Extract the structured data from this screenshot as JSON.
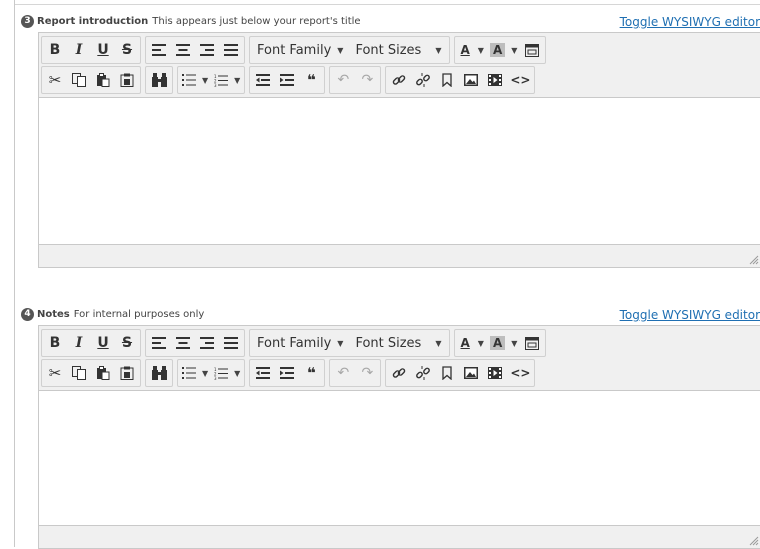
{
  "common": {
    "toggle_label": "Toggle WYSIWYG editor",
    "font_family_label": "Font Family",
    "font_sizes_label": "Font Sizes",
    "text_color_label": "A",
    "bg_color_label": "A",
    "bold": "B",
    "italic": "I",
    "underline": "U",
    "strikethrough": "S",
    "quote_glyph": "❝",
    "source_code_glyph": "<>"
  },
  "sections": [
    {
      "number": "3",
      "title": "Report introduction",
      "hint": "This appears just below your report's title"
    },
    {
      "number": "4",
      "title": "Notes",
      "hint": "For internal purposes only"
    }
  ],
  "toolbar_icons": {
    "row1": [
      "bold",
      "italic",
      "underline",
      "strikethrough",
      "align-left-icon",
      "align-center-icon",
      "align-right-icon",
      "align-justify-icon",
      "font-family-select",
      "font-sizes-select",
      "text-color",
      "background-color",
      "fullscreen-icon"
    ],
    "row2": [
      "cut-icon",
      "copy-icon",
      "paste-icon",
      "paste-text-icon",
      "find-replace-icon",
      "bullet-list-icon",
      "numbered-list-icon",
      "outdent-icon",
      "indent-icon",
      "blockquote-icon",
      "undo-icon",
      "redo-icon",
      "link-icon",
      "unlink-icon",
      "bookmark-icon",
      "image-icon",
      "media-icon",
      "source-code-icon"
    ]
  }
}
